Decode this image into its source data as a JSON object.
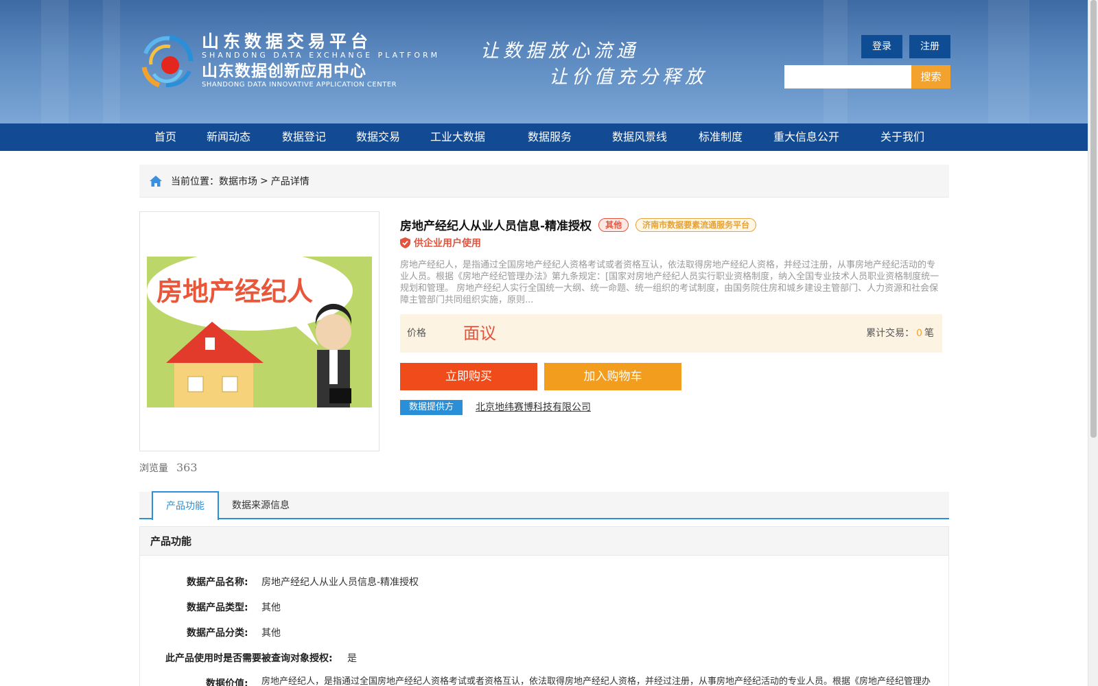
{
  "header": {
    "logo": {
      "cn_title": "山东数据交易平台",
      "en_title": "SHANDONG DATA EXCHANGE PLATFORM",
      "cn_subtitle": "山东数据创新应用中心",
      "en_subtitle": "SHANDONG DATA INNOVATIVE APPLICATION CENTER"
    },
    "slogan_line1": "让数据放心流通",
    "slogan_line2": "让价值充分释放",
    "login_label": "登录",
    "register_label": "注册",
    "search_placeholder": "",
    "search_button": "搜索"
  },
  "nav": {
    "items": [
      "首页",
      "新闻动态",
      "数据登记",
      "数据交易",
      "工业大数据",
      "数据服务",
      "数据风景线",
      "标准制度",
      "重大信息公开",
      "关于我们"
    ]
  },
  "breadcrumb": {
    "prefix": "当前位置：",
    "market": "数据市场",
    "separator": ">",
    "current": "产品详情"
  },
  "product": {
    "image_text": "房地产经纪人",
    "title": "房地产经纪人从业人员信息-精准授权",
    "tag_category": "其他",
    "tag_platform": "济南市数据要素流通服务平台",
    "usage": "供企业用户使用",
    "description": "房地产经纪人，是指通过全国房地产经纪人资格考试或者资格互认，依法取得房地产经纪人资格，并经过注册，从事房地产经纪活动的专业人员。根据《房地产经纪管理办法》第九条规定：[国家对房地产经纪人员实行职业资格制度，纳入全国专业技术人员职业资格制度统一规划和管理。 房地产经纪人实行全国统一大纲、统一命题、统一组织的考试制度，由国务院住房和城乡建设主管部门、人力资源和社会保障主管部门共同组织实施，原则...",
    "price_label": "价格",
    "price_value": "面议",
    "trade_label": "累计交易：",
    "trade_count": "0",
    "trade_unit": "笔",
    "buy_button": "立即购买",
    "cart_button": "加入购物车",
    "provider_label": "数据提供方",
    "provider_name": "北京地纬赛博科技有限公司",
    "views_label": "浏览量",
    "views_count": "363"
  },
  "tabs": {
    "items": [
      "产品功能",
      "数据来源信息"
    ],
    "active": "产品功能"
  },
  "section": {
    "title": "产品功能",
    "fields": [
      {
        "label": "数据产品名称:",
        "value": "房地产经纪人从业人员信息-精准授权"
      },
      {
        "label": "数据产品类型:",
        "value": "其他"
      },
      {
        "label": "数据产品分类:",
        "value": "其他"
      },
      {
        "label": "此产品使用时是否需要被查询对象授权:",
        "value": "是"
      },
      {
        "label": "数据价值:",
        "value": "房地产经纪人，是指通过全国房地产经纪人资格考试或者资格互认，依法取得房地产经纪人资格，并经过注册，从事房地产经纪活动的专业人员。根据《房地产经纪管理办法》第九条规定：[国家对房地产经纪人员实行职业资格制度，纳入全国专业技术人员职业资格制度统一规划和管理。房地产经纪人实行全国统一大"
      }
    ]
  },
  "colors": {
    "nav_bg": "#124a93",
    "accent_blue": "#2a8fd6",
    "buy_red": "#f04b1b",
    "cart_orange": "#f29d1d",
    "price_red": "#e5533d"
  }
}
